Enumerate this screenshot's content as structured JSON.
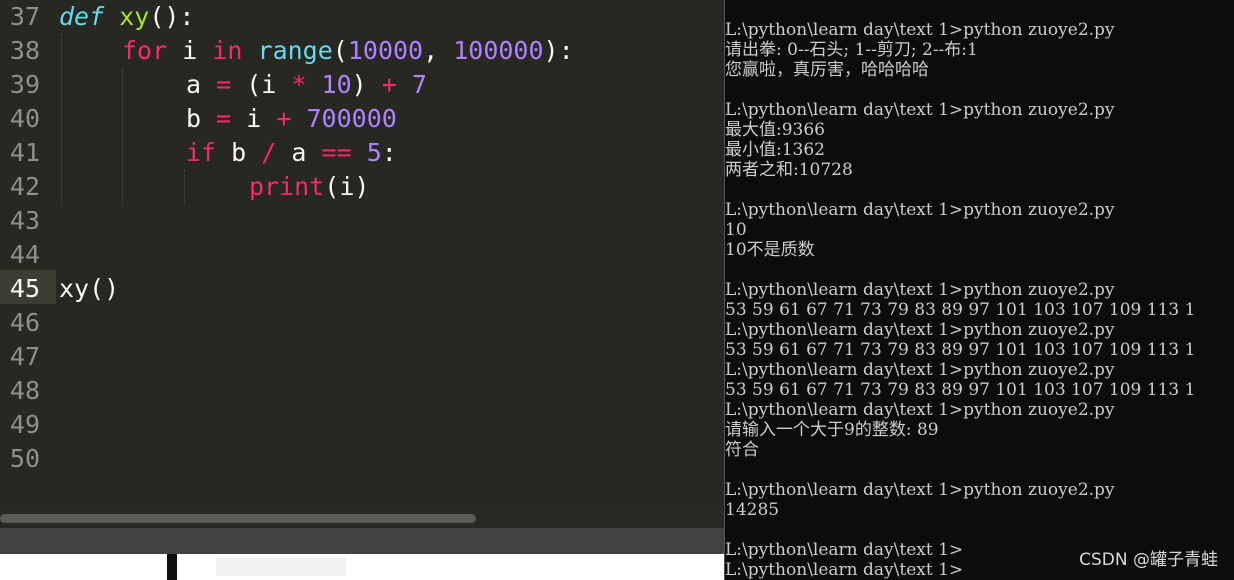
{
  "editor": {
    "line_numbers": [
      "37",
      "38",
      "39",
      "40",
      "41",
      "42",
      "43",
      "44",
      "45",
      "46",
      "47",
      "48",
      "49",
      "50"
    ],
    "active_line": "45",
    "code": {
      "l37": {
        "def": "def",
        "name": "xy",
        "rest": "():"
      },
      "l38": {
        "for": "for",
        "var": "i",
        "in": "in",
        "range": "range",
        "open": "(",
        "a": "10000",
        "comma": ", ",
        "b": "100000",
        "close": "):"
      },
      "l39": {
        "name": "a",
        "eq": "=",
        "open": "(i",
        "mul": "*",
        "ten": "10",
        "close": ")",
        "plus": "+",
        "seven": "7"
      },
      "l40": {
        "name": "b",
        "eq": "=",
        "i": "i",
        "plus": "+",
        "num": "700000"
      },
      "l41": {
        "if": "if",
        "b": "b",
        "div": "/",
        "a": "a",
        "eqeq": "==",
        "five": "5",
        "colon": ":"
      },
      "l42": {
        "print": "print",
        "args": "(i)"
      },
      "l45": {
        "call": "xy()"
      }
    }
  },
  "terminal": {
    "lines": [
      "L:\\python\\learn day\\text 1>python zuoye2.py",
      "请出拳: 0--石头; 1--剪刀; 2--布:1",
      "您赢啦，真厉害，哈哈哈哈",
      "",
      "L:\\python\\learn day\\text 1>python zuoye2.py",
      "最大值:9366",
      "最小值:1362",
      "两者之和:10728",
      "",
      "L:\\python\\learn day\\text 1>python zuoye2.py",
      "10",
      "10不是质数",
      "",
      "L:\\python\\learn day\\text 1>python zuoye2.py",
      "53 59 61 67 71 73 79 83 89 97 101 103 107 109 113 1",
      "L:\\python\\learn day\\text 1>python zuoye2.py",
      "53 59 61 67 71 73 79 83 89 97 101 103 107 109 113 1",
      "L:\\python\\learn day\\text 1>python zuoye2.py",
      "53 59 61 67 71 73 79 83 89 97 101 103 107 109 113 1",
      "L:\\python\\learn day\\text 1>python zuoye2.py",
      "请输入一个大于9的整数: 89",
      "符合",
      "",
      "L:\\python\\learn day\\text 1>python zuoye2.py",
      "14285",
      "",
      "L:\\python\\learn day\\text 1>",
      "L:\\python\\learn day\\text 1>"
    ]
  },
  "watermark": "CSDN @罐子青蛙"
}
